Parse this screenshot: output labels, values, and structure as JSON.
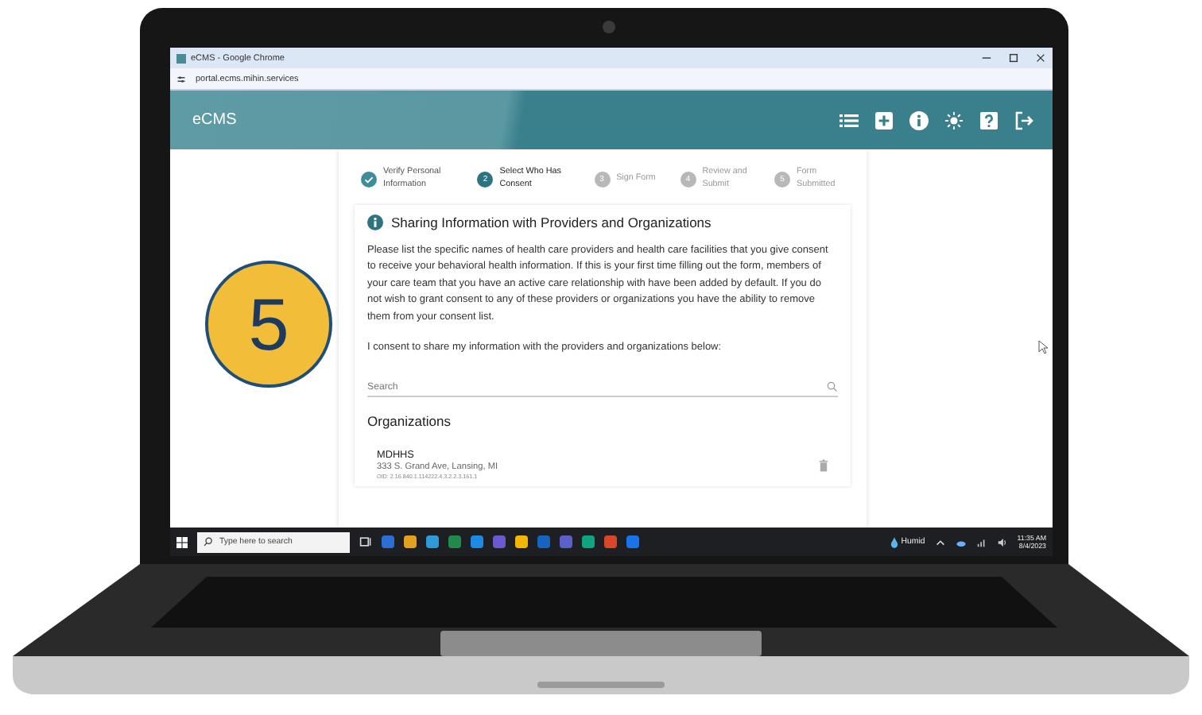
{
  "browser": {
    "title": "eCMS - Google Chrome",
    "url": "portal.ecms.mihin.services"
  },
  "app": {
    "title": "eCMS"
  },
  "steps": [
    {
      "label": "Verify Personal Information",
      "kind": "completed"
    },
    {
      "label": "Select Who Has Consent",
      "number": "2",
      "kind": "current"
    },
    {
      "label": "Sign Form",
      "number": "3",
      "kind": "upcoming"
    },
    {
      "label": "Review and Submit",
      "number": "4",
      "kind": "upcoming"
    },
    {
      "label": "Form Submitted",
      "number": "5",
      "kind": "upcoming"
    }
  ],
  "section": {
    "title": "Sharing Information with Providers and Organizations",
    "body": "Please list the specific names of health care providers and health care facilities that you give consent to receive your behavioral health information. If this is your first time filling out the form, members of your care team that you have an active care relationship with have been added by default. If you do not wish to grant consent to any of these providers or organizations you have the ability to remove them from your consent list.",
    "consent": "I consent to share my information with the providers and organizations below:"
  },
  "search": {
    "placeholder": "Search"
  },
  "organizations": {
    "title": "Organizations",
    "items": [
      {
        "name": "MDHHS",
        "address": "333 S. Grand Ave, Lansing, MI",
        "oid": "OID: 2.16.840.1.114222.4.3.2.2.3.161.1"
      }
    ]
  },
  "taskbar": {
    "search_placeholder": "Type here to search",
    "weather": "Humid",
    "time": "11:35 AM",
    "date": "8/4/2023"
  },
  "step_badge": "5"
}
